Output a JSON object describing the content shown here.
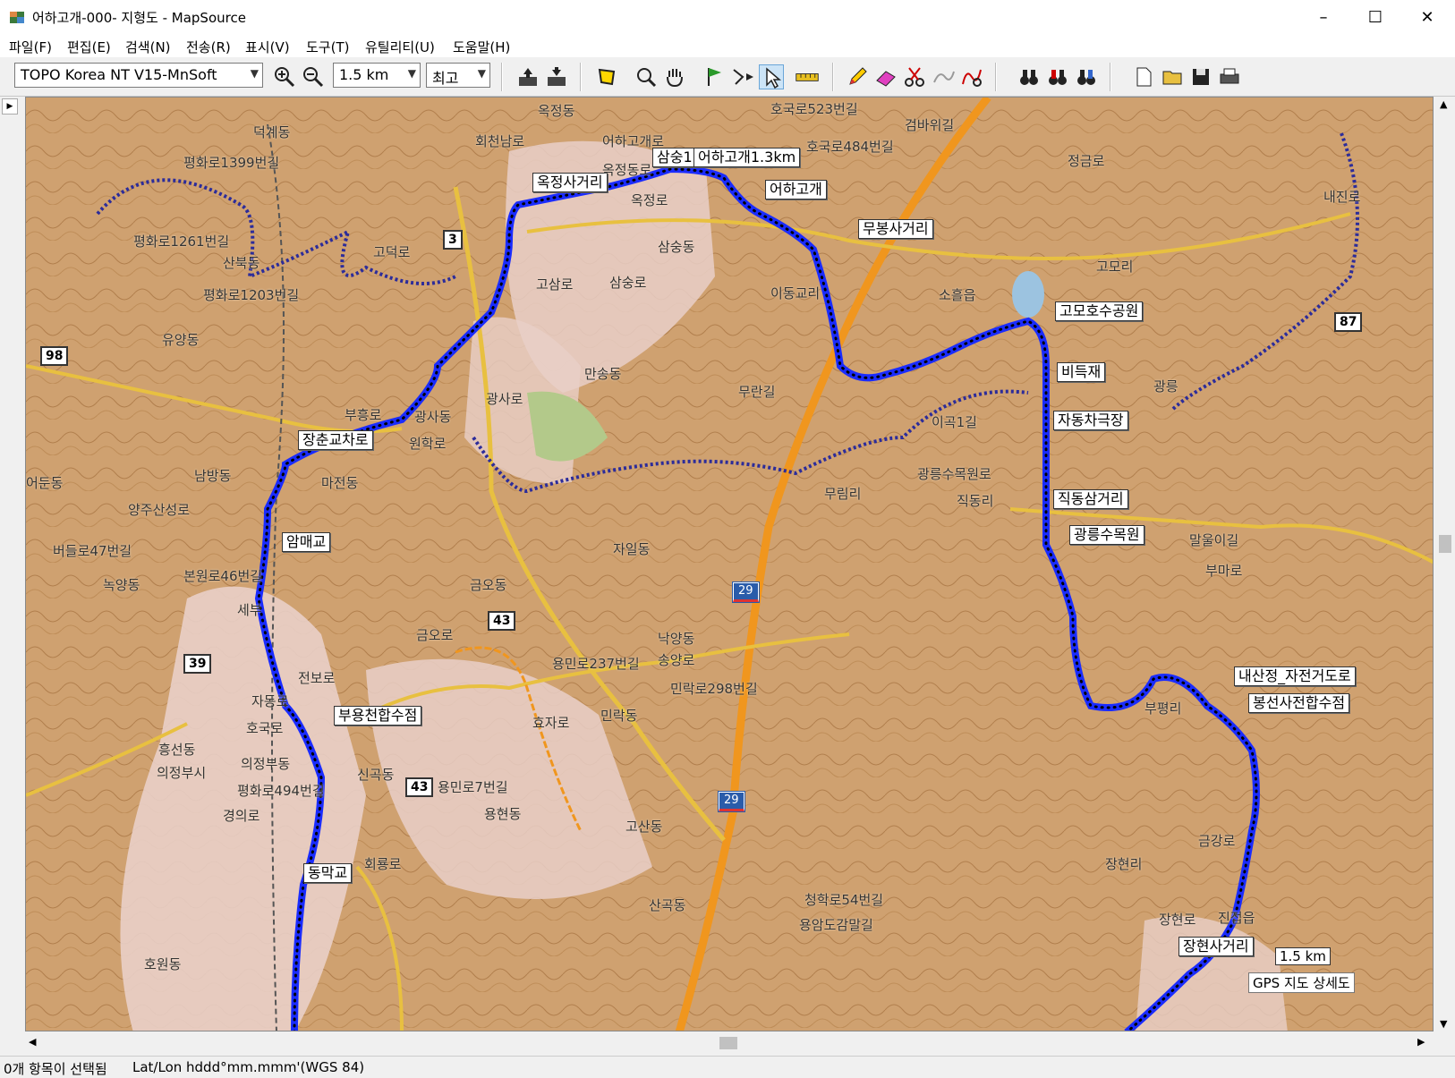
{
  "window": {
    "title": "어하고개-000- 지형도 - MapSource",
    "minimize": "–",
    "maximize": "☐",
    "close": "✕"
  },
  "menu": [
    "파일(F)",
    "편집(E)",
    "검색(N)",
    "전송(R)",
    "표시(V)",
    "도구(T)",
    "유틸리티(U)",
    "도움말(H)"
  ],
  "toolbar": {
    "map_product": "TOPO Korea NT V15-MnSoft",
    "zoom_scale": "1.5 km",
    "detail": "최고"
  },
  "map": {
    "waypoints": [
      "옥정사거리",
      "삼숭1",
      "어하고개1.3km",
      "어하고개",
      "무봉사거리",
      "고모호수공원",
      "비득재",
      "자동차극장",
      "직동삼거리",
      "광릉수목원",
      "내산정_자전거도로",
      "봉선사전합수점",
      "장현사거리",
      "동막교",
      "부용천합수점",
      "암매교",
      "장춘교차로"
    ],
    "places": [
      "옥정동",
      "회천남로",
      "어하고개로",
      "옥정동로",
      "옥정로",
      "호국로523번길",
      "호국로484번길",
      "검바위길",
      "삼숭동",
      "고삼로",
      "삼숭로",
      "이동교리",
      "소흘읍",
      "고모리",
      "정금로",
      "덕계동",
      "고덕로",
      "산북동",
      "유양동",
      "평화로1399번길",
      "평화로1261번길",
      "평화로1203번길",
      "부흥로",
      "만송동",
      "광사로",
      "광사동",
      "원학로",
      "마전동",
      "남방동",
      "어둔동",
      "양주산성로",
      "버들로47번길",
      "녹양동",
      "본원로46번길",
      "세부",
      "금오동",
      "자일동",
      "무림리",
      "광릉수목원로",
      "이곡1길",
      "무란길",
      "금오로",
      "전보로",
      "자동로",
      "호국로",
      "의정부동",
      "의정부시",
      "평화로494번길",
      "경의로",
      "신곡동",
      "회룡로",
      "용민로7번길",
      "용현동",
      "고산동",
      "산곡동",
      "용민로237번길",
      "낙양동",
      "송양로",
      "민락로298번길",
      "민락동",
      "효자로",
      "부평리",
      "장현리",
      "말울이길",
      "부마로",
      "금강로",
      "진접읍",
      "청학로54번길",
      "용암도감말길",
      "호원동",
      "흥선동",
      "내진로",
      "광릉",
      "직동리",
      "장현로"
    ],
    "roads": [
      "3",
      "98",
      "39",
      "43",
      "43",
      "87",
      "29",
      "29"
    ],
    "scale_text": "1.5 km",
    "overlay_text": "GPS 지도 상세도"
  },
  "status": {
    "selection": "0개 항목이 선택됨",
    "coords_format": "Lat/Lon hddd°mm.mmm'(WGS 84)"
  },
  "colors": {
    "track": "#1a2cff",
    "terrain": "#c99a6a",
    "urban": "#e8c8c0",
    "highway": "#f0961e",
    "boundary": "#3a3aa0"
  }
}
